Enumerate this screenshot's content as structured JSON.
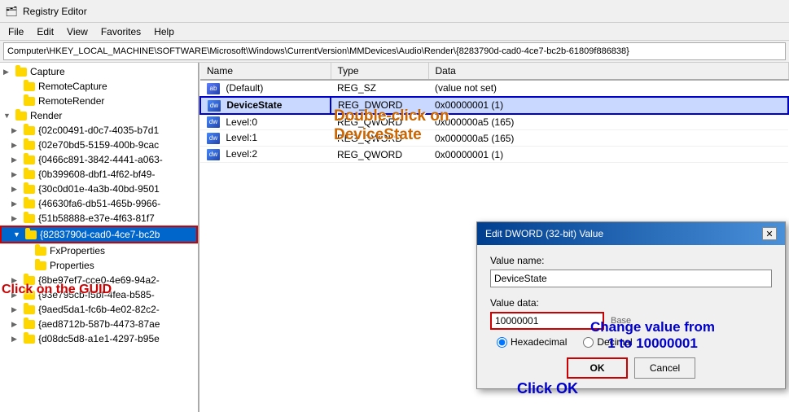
{
  "app": {
    "title": "Registry Editor",
    "icon": "🗂"
  },
  "menu": {
    "items": [
      "File",
      "Edit",
      "View",
      "Favorites",
      "Help"
    ]
  },
  "address_bar": {
    "path": "Computer\\HKEY_LOCAL_MACHINE\\SOFTWARE\\Microsoft\\Windows\\CurrentVersion\\MMDevices\\Audio\\Render\\{8283790d-cad0-4ce7-bc2b-61809f886838}"
  },
  "tree": {
    "items": [
      {
        "label": "Capture",
        "indent": 0,
        "arrow": "▶",
        "expanded": false,
        "selected": false
      },
      {
        "label": "RemoteCapture",
        "indent": 1,
        "arrow": "",
        "expanded": false,
        "selected": false
      },
      {
        "label": "RemoteRender",
        "indent": 1,
        "arrow": "",
        "expanded": false,
        "selected": false
      },
      {
        "label": "Render",
        "indent": 0,
        "arrow": "▼",
        "expanded": true,
        "selected": false
      },
      {
        "label": "{02c00491-d0c7-4035-b7d1",
        "indent": 1,
        "arrow": "▶",
        "expanded": false,
        "selected": false
      },
      {
        "label": "{02e70bd5-5159-400b-9cac",
        "indent": 1,
        "arrow": "▶",
        "expanded": false,
        "selected": false
      },
      {
        "label": "{0466c891-3842-4441-a063-",
        "indent": 1,
        "arrow": "▶",
        "expanded": false,
        "selected": false
      },
      {
        "label": "{0b399608-dbf1-4f62-bf49-",
        "indent": 1,
        "arrow": "▶",
        "expanded": false,
        "selected": false
      },
      {
        "label": "{30c0d01e-4a3b-40bd-9501",
        "indent": 1,
        "arrow": "▶",
        "expanded": false,
        "selected": false
      },
      {
        "label": "{46630fa6-db51-465b-9966-",
        "indent": 1,
        "arrow": "▶",
        "expanded": false,
        "selected": false
      },
      {
        "label": "{51b58888-e37e-4f63-81f7",
        "indent": 1,
        "arrow": "▶",
        "expanded": false,
        "selected": false
      },
      {
        "label": "{8283790d-cad0-4ce7-bc2b",
        "indent": 1,
        "arrow": "▼",
        "expanded": true,
        "selected": true,
        "highlighted": true
      },
      {
        "label": "FxProperties",
        "indent": 2,
        "arrow": "",
        "expanded": false,
        "selected": false
      },
      {
        "label": "Properties",
        "indent": 2,
        "arrow": "",
        "expanded": false,
        "selected": false
      },
      {
        "label": "{8be97ef7-cce0-4e69-94a2-",
        "indent": 1,
        "arrow": "▶",
        "expanded": false,
        "selected": false
      },
      {
        "label": "{93e795cb-f5bf-4fea-b585-",
        "indent": 1,
        "arrow": "▶",
        "expanded": false,
        "selected": false
      },
      {
        "label": "{9aed5da1-fc6b-4e02-82c2-",
        "indent": 1,
        "arrow": "▶",
        "expanded": false,
        "selected": false
      },
      {
        "label": "{aed8712b-587b-4473-87ae",
        "indent": 1,
        "arrow": "▶",
        "expanded": false,
        "selected": false
      },
      {
        "label": "{d08dc5d8-a1e1-4297-b95e",
        "indent": 1,
        "arrow": "▶",
        "expanded": false,
        "selected": false
      }
    ]
  },
  "registry_table": {
    "columns": [
      "Name",
      "Type",
      "Data"
    ],
    "rows": [
      {
        "name": "(Default)",
        "icon": "ab",
        "type": "REG_SZ",
        "data": "(value not set)"
      },
      {
        "name": "DeviceState",
        "icon": "dw",
        "type": "REG_DWORD",
        "data": "0x00000001 (1)",
        "highlighted": true
      },
      {
        "name": "Level:0",
        "icon": "dw",
        "type": "REG_QWORD",
        "data": "0x000000a5 (165)"
      },
      {
        "name": "Level:1",
        "icon": "dw",
        "type": "REG_QWORD",
        "data": "0x000000a5 (165)"
      },
      {
        "name": "Level:2",
        "icon": "dw",
        "type": "REG_QWORD",
        "data": "0x00000001 (1)"
      }
    ]
  },
  "annotations": {
    "double_click": "Double-click on\nDeviceState",
    "click_guid": "Click on the GUID",
    "change_value": "Change value from\n1 to 10000001",
    "click_ok": "Click OK"
  },
  "dialog": {
    "title": "Edit DWORD (32-bit) Value",
    "value_name_label": "Value name:",
    "value_name": "DeviceState",
    "value_data_label": "Value data:",
    "value_data": "10000001",
    "base_label": "Base",
    "base_options": [
      "Hexadecimal",
      "Decimal"
    ],
    "base_selected": "Hexadecimal",
    "ok_label": "OK",
    "cancel_label": "Cancel"
  }
}
